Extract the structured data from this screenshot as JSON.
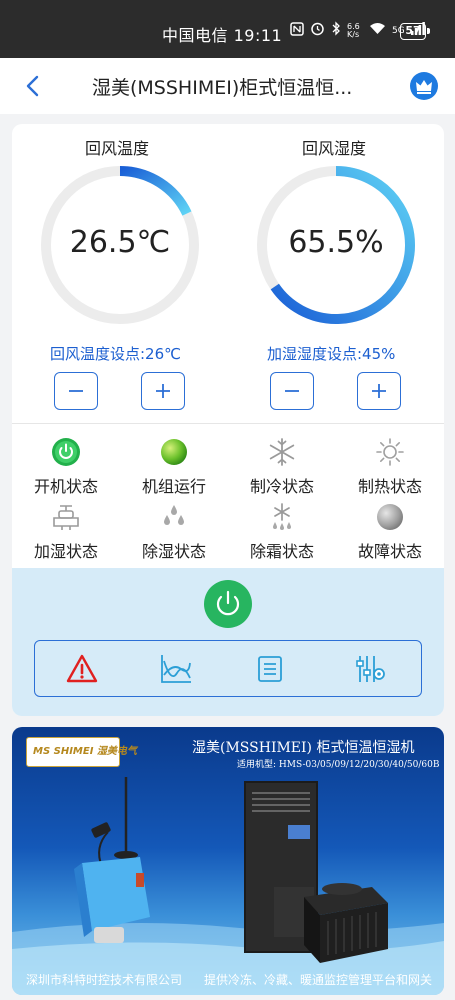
{
  "status_bar": {
    "carrier_time": "中国电信 19:11",
    "network_speed": "6.6 K/s",
    "signal": "5G",
    "battery": "57"
  },
  "header": {
    "title": "湿美(MSSHIMEI)柜式恒温恒...",
    "back_icon": "chevron-left-icon",
    "vip_icon": "crown-icon"
  },
  "gauges": [
    {
      "label": "回风温度",
      "value": "26.5℃",
      "setpoint": "回风温度设点:26℃",
      "fill_fraction": 0.18
    },
    {
      "label": "回风湿度",
      "value": "65.5%",
      "setpoint": "加湿湿度设点:45%",
      "fill_fraction": 0.655
    }
  ],
  "stepper": {
    "minus_icon": "minus-icon",
    "plus_icon": "plus-icon"
  },
  "states": [
    {
      "label": "开机状态",
      "icon": "power-on-icon"
    },
    {
      "label": "机组运行",
      "icon": "run-indicator-icon"
    },
    {
      "label": "制冷状态",
      "icon": "snowflake-icon"
    },
    {
      "label": "制热状态",
      "icon": "sun-icon"
    },
    {
      "label": "加湿状态",
      "icon": "humidifier-valve-icon"
    },
    {
      "label": "除湿状态",
      "icon": "water-drops-icon"
    },
    {
      "label": "除霜状态",
      "icon": "defrost-icon"
    },
    {
      "label": "故障状态",
      "icon": "fault-indicator-icon"
    }
  ],
  "controls": {
    "power_icon": "power-button-icon",
    "tools": [
      "alarm-icon",
      "chart-icon",
      "list-icon",
      "settings-sliders-icon"
    ]
  },
  "banner": {
    "logo": "MS SHIMEI 湿美电气",
    "title": "湿美(MSSHIMEI) 柜式恒温恒湿机",
    "models": "适用机型: HMS-03/05/09/12/20/30/40/50/60B",
    "footer_left": "深圳市科特时控技术有限公司",
    "footer_right": "提供冷冻、冷藏、暖通监控管理平台和网关"
  },
  "colors": {
    "accent": "#2c6fd6",
    "gauge_track": "#ececec",
    "gauge_start": "#1a5fd6",
    "gauge_end": "#5fd3f5",
    "power_green": "#27b560",
    "alert_red": "#e02020"
  }
}
